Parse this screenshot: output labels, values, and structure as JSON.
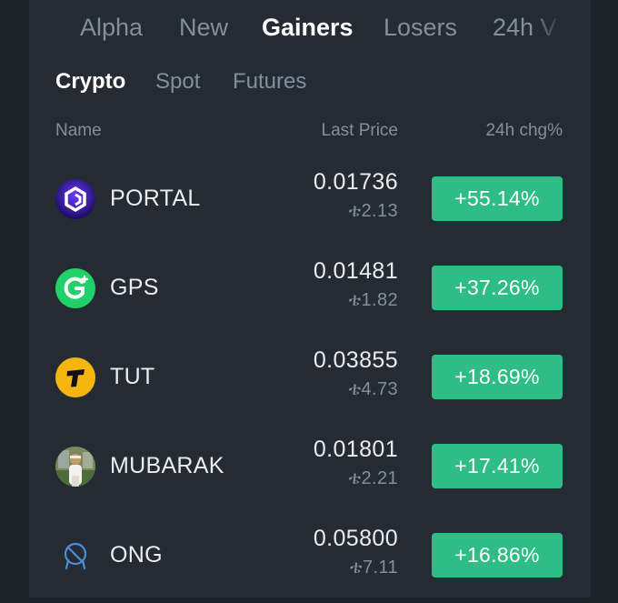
{
  "top_tabs": [
    "Alpha",
    "New",
    "Gainers",
    "Losers",
    "24h V"
  ],
  "top_tab_active": "Gainers",
  "sub_tabs": [
    "Crypto",
    "Spot",
    "Futures"
  ],
  "sub_tab_active": "Crypto",
  "columns": {
    "name": "Name",
    "price": "Last Price",
    "change": "24h chg%"
  },
  "colors": {
    "background": "#1e2329",
    "panel": "#252b33",
    "positive": "#2ebd85",
    "muted": "#848e9c",
    "text": "#eaecef"
  },
  "rows": [
    {
      "symbol": "PORTAL",
      "icon": "portal-logo-icon",
      "price": "0.01736",
      "fiat": "ቴ2.13",
      "change": "+55.14%"
    },
    {
      "symbol": "GPS",
      "icon": "gps-logo-icon",
      "price": "0.01481",
      "fiat": "ቴ1.82",
      "change": "+37.26%"
    },
    {
      "symbol": "TUT",
      "icon": "tut-logo-icon",
      "price": "0.03855",
      "fiat": "ቴ4.73",
      "change": "+18.69%"
    },
    {
      "symbol": "MUBARAK",
      "icon": "mubarak-avatar-icon",
      "price": "0.01801",
      "fiat": "ቴ2.21",
      "change": "+17.41%"
    },
    {
      "symbol": "ONG",
      "icon": "ong-logo-icon",
      "price": "0.05800",
      "fiat": "ቴ7.11",
      "change": "+16.86%"
    }
  ]
}
